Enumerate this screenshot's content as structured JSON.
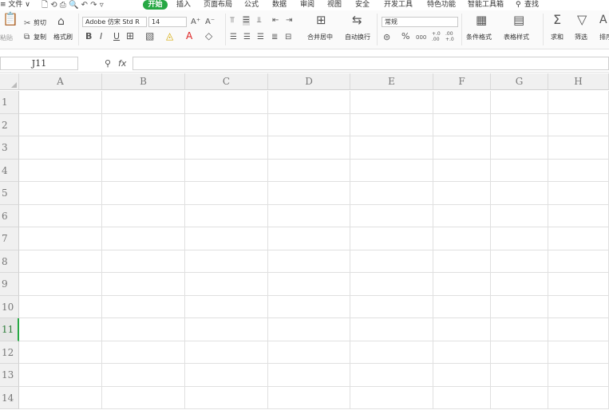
{
  "menubar": {
    "items": [
      {
        "label": "≡ 文件 ∨",
        "name": "menu-file"
      },
      {
        "label": "开始",
        "name": "menu-start"
      },
      {
        "label": "插入",
        "name": "menu-insert"
      },
      {
        "label": "页面布局",
        "name": "menu-page-layout"
      },
      {
        "label": "公式",
        "name": "menu-formula"
      },
      {
        "label": "数据",
        "name": "menu-data"
      },
      {
        "label": "审阅",
        "name": "menu-review"
      },
      {
        "label": "视图",
        "name": "menu-view"
      },
      {
        "label": "安全",
        "name": "menu-security"
      },
      {
        "label": "开发工具",
        "name": "menu-developer"
      },
      {
        "label": "特色功能",
        "name": "menu-features"
      },
      {
        "label": "智能工具箱",
        "name": "menu-smart-tools"
      },
      {
        "label": "查找",
        "name": "menu-search"
      }
    ]
  },
  "ribbon": {
    "paste_label": "粘贴",
    "cut_label": "剪切",
    "copy_label": "复制",
    "format_painter_label": "格式刷",
    "font_name": "Adobe 仿宋 Std R",
    "font_size": "14",
    "bold": "B",
    "italic": "I",
    "underline": "U",
    "merge_label": "合并居中",
    "wrap_label": "自动换行",
    "number_format": "常规",
    "percent": "%",
    "thousands": "000",
    "inc_decimal": "+.0 .00",
    "dec_decimal": ".00 +.0",
    "cond_format_label": "条件格式",
    "table_style_label": "表格样式",
    "sum_label": "求和",
    "filter_label": "筛选",
    "sort_label": "排序"
  },
  "formula_bar": {
    "cell_ref": "J11",
    "fx_label": "fx",
    "value": ""
  },
  "sheet": {
    "columns": [
      "A",
      "B",
      "C",
      "D",
      "E",
      "F",
      "G",
      "H"
    ],
    "rows": [
      "1",
      "2",
      "3",
      "4",
      "5",
      "6",
      "7",
      "8",
      "9",
      "10",
      "11",
      "12",
      "13",
      "14"
    ],
    "active_row": "11",
    "accent": "#27a844"
  }
}
